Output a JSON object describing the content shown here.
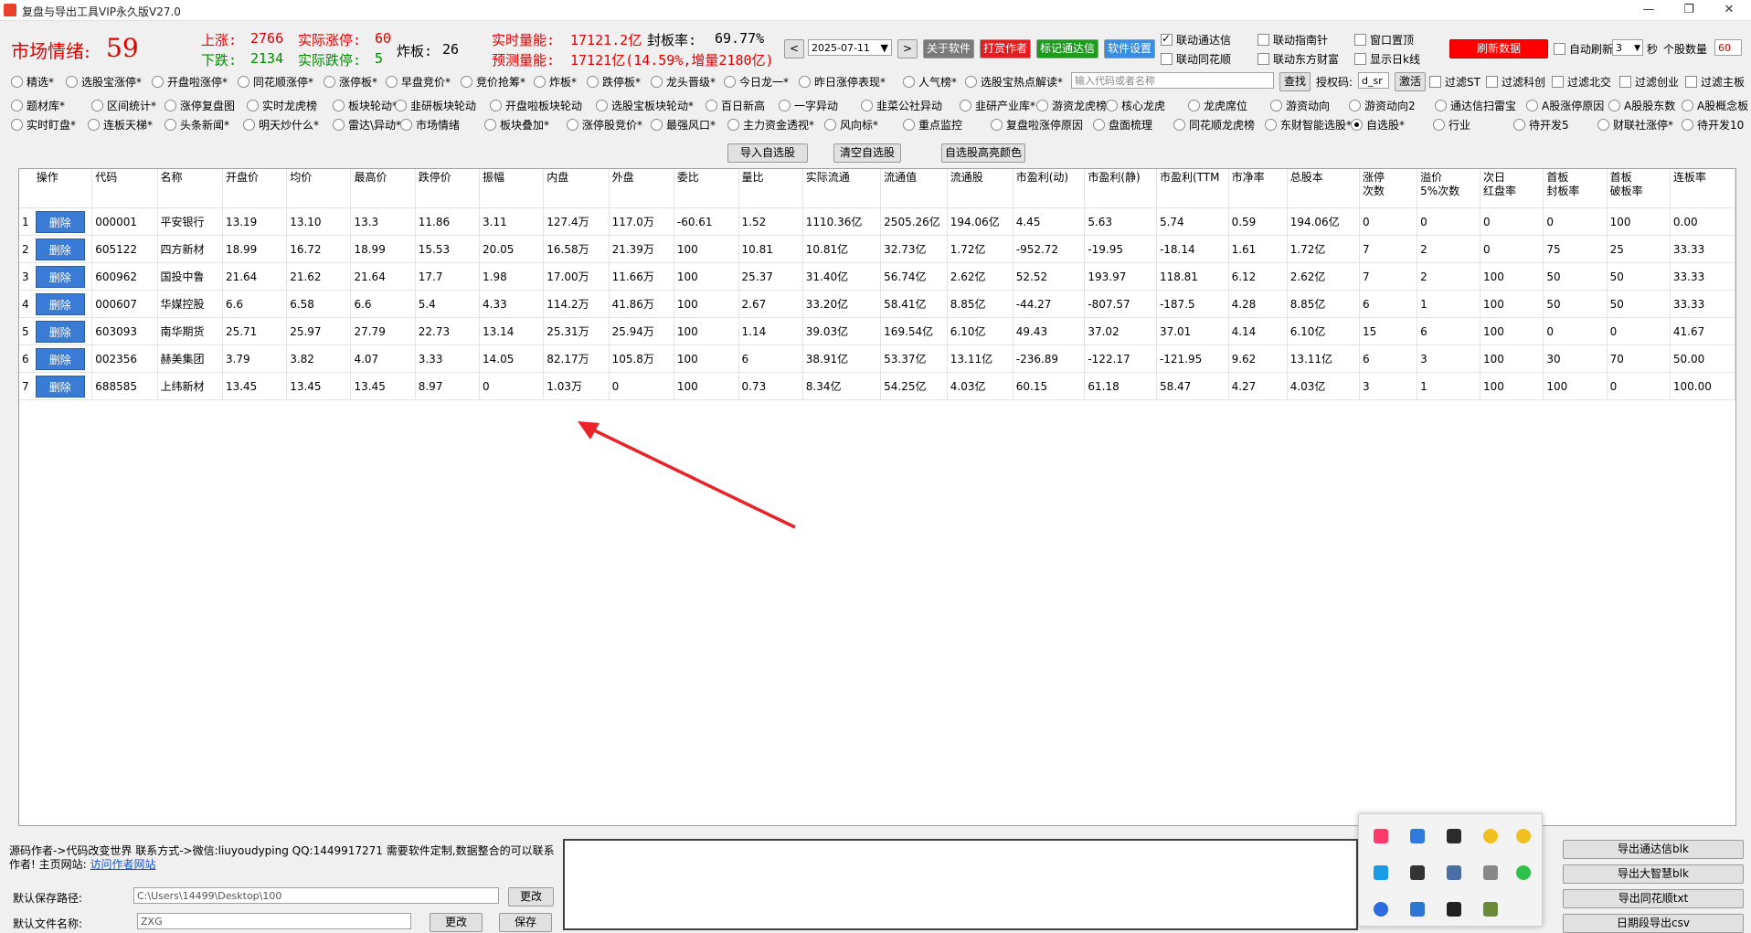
{
  "window": {
    "title": "复盘与导出工具VIP永久版V27.0",
    "min": "—",
    "max": "❐",
    "close": "✕"
  },
  "stats": {
    "mood_label": "市场情绪:",
    "mood_value": "59",
    "up_label": "上涨:",
    "up_value": "2766",
    "limit_up_label": "实际涨停:",
    "limit_up_value": "60",
    "down_label": "下跌:",
    "down_value": "2134",
    "limit_down_label": "实际跌停:",
    "limit_down_value": "5",
    "broken_label": "炸板:",
    "broken_value": "26",
    "volume_label": "实时量能:",
    "volume_value": "17121.2亿",
    "seal_label": "封板率:",
    "seal_value": "69.77%",
    "forecast_label": "预测量能:",
    "forecast_value": "17121亿(14.59%,增量2180亿)"
  },
  "toolbar": {
    "prev": "<",
    "date": "2025-07-11",
    "next": ">",
    "about": "关于软件",
    "tip": "打赏作者",
    "mark": "标记通达信",
    "settings": "软件设置",
    "refresh": "刷新数据",
    "auto_refresh": "自动刷新",
    "interval": "3",
    "seconds": "秒",
    "count_label": "个股数量",
    "count_value": "60",
    "link_tdx": "联动通达信",
    "link_ths": "联动同花顺",
    "link_znz": "联动指南针",
    "link_dfcf": "联动东方财富",
    "pin_window": "窗口置顶",
    "show_daily": "显示日k线",
    "search_placeholder": "输入代码或者名称",
    "search_btn": "查找",
    "auth_label": "授权码:",
    "auth_value": "d_sr",
    "activate": "激活",
    "filter_st": "过滤ST",
    "filter_kc": "过滤科创",
    "filter_bj": "过滤北交",
    "filter_cy": "过滤创业",
    "filter_main": "过滤主板"
  },
  "radios": {
    "row1": [
      "精选*",
      "选股宝涨停*",
      "开盘啦涨停*",
      "同花顺涨停*",
      "涨停板*",
      "早盘竞价*",
      "竞价抢筹*",
      "炸板*",
      "跌停板*",
      "龙头晋级*",
      "今日龙一*",
      "昨日涨停表现*",
      "人气榜*",
      "选股宝热点解读*"
    ],
    "row2": [
      "题材库*",
      "区间统计*",
      "涨停复盘图",
      "实时龙虎榜",
      "板块轮动*",
      "韭研板块轮动",
      "开盘啦板块轮动",
      "选股宝板块轮动*",
      "百日新高",
      "一字异动",
      "韭菜公社异动",
      "韭研产业库*",
      "游资龙虎榜",
      "核心龙虎",
      "龙虎席位",
      "游资动向",
      "游资动向2",
      "通达信扫雷宝",
      "A股涨停原因",
      "A股股东数",
      "A股概念板"
    ],
    "row3": [
      "实时盯盘*",
      "连板天梯*",
      "头条新闻*",
      "明天炒什么*",
      "雷达\\异动*",
      "市场情绪",
      "板块叠加*",
      "涨停股竞价*",
      "最强风口*",
      "主力资金透视*",
      "风向标*",
      "重点监控",
      "复盘啦涨停原因",
      "盘面梳理",
      "同花顺龙虎榜",
      "东财智能选股*",
      "自选股*",
      "行业",
      "待开发5",
      "财联社涨停*",
      "待开发10"
    ]
  },
  "actions": {
    "import": "导入自选股",
    "clear": "清空自选股",
    "highlight": "自选股高亮颜色"
  },
  "table": {
    "headers": [
      "操作",
      "代码",
      "名称",
      "开盘价",
      "均价",
      "最高价",
      "跌停价",
      "振幅",
      "内盘",
      "外盘",
      "委比",
      "量比",
      "实际流通",
      "流通值",
      "流通股",
      "市盈利(动)",
      "市盈利(静)",
      "市盈利(TTM",
      "市净率",
      "总股本",
      "涨停\n次数",
      "溢价\n5%次数",
      "次日\n红盘率",
      "首板\n封板率",
      "首板\n破板率",
      "连板率"
    ],
    "delete_label": "删除",
    "rows": [
      [
        "1",
        "000001",
        "平安银行",
        "13.19",
        "13.10",
        "13.3",
        "11.86",
        "3.11",
        "127.4万",
        "117.0万",
        "-60.61",
        "1.52",
        "1110.36亿",
        "2505.26亿",
        "194.06亿",
        "4.45",
        "5.63",
        "5.74",
        "0.59",
        "194.06亿",
        "0",
        "0",
        "0",
        "0",
        "100",
        "0.00"
      ],
      [
        "2",
        "605122",
        "四方新材",
        "18.99",
        "16.72",
        "18.99",
        "15.53",
        "20.05",
        "16.58万",
        "21.39万",
        "100",
        "10.81",
        "10.81亿",
        "32.73亿",
        "1.72亿",
        "-952.72",
        "-19.95",
        "-18.14",
        "1.61",
        "1.72亿",
        "7",
        "2",
        "0",
        "75",
        "25",
        "33.33"
      ],
      [
        "3",
        "600962",
        "国投中鲁",
        "21.64",
        "21.62",
        "21.64",
        "17.7",
        "1.98",
        "17.00万",
        "11.66万",
        "100",
        "25.37",
        "31.40亿",
        "56.74亿",
        "2.62亿",
        "52.52",
        "193.97",
        "118.81",
        "6.12",
        "2.62亿",
        "7",
        "2",
        "100",
        "50",
        "50",
        "33.33"
      ],
      [
        "4",
        "000607",
        "华媒控股",
        "6.6",
        "6.58",
        "6.6",
        "5.4",
        "4.33",
        "114.2万",
        "41.86万",
        "100",
        "2.67",
        "33.20亿",
        "58.41亿",
        "8.85亿",
        "-44.27",
        "-807.57",
        "-187.5",
        "4.28",
        "8.85亿",
        "6",
        "1",
        "100",
        "50",
        "50",
        "33.33"
      ],
      [
        "5",
        "603093",
        "南华期货",
        "25.71",
        "25.97",
        "27.79",
        "22.73",
        "13.14",
        "25.31万",
        "25.94万",
        "100",
        "1.14",
        "39.03亿",
        "169.54亿",
        "6.10亿",
        "49.43",
        "37.02",
        "37.01",
        "4.14",
        "6.10亿",
        "15",
        "6",
        "100",
        "0",
        "0",
        "41.67"
      ],
      [
        "6",
        "002356",
        "赫美集团",
        "3.79",
        "3.82",
        "4.07",
        "3.33",
        "14.05",
        "82.17万",
        "105.8万",
        "100",
        "6",
        "38.91亿",
        "53.37亿",
        "13.11亿",
        "-236.89",
        "-122.17",
        "-121.95",
        "9.62",
        "13.11亿",
        "6",
        "3",
        "100",
        "30",
        "70",
        "50.00"
      ],
      [
        "7",
        "688585",
        "上纬新材",
        "13.45",
        "13.45",
        "13.45",
        "8.97",
        "0",
        "1.03万",
        "0",
        "100",
        "0.73",
        "8.34亿",
        "54.25亿",
        "4.03亿",
        "60.15",
        "61.18",
        "58.47",
        "4.27",
        "4.03亿",
        "3",
        "1",
        "100",
        "100",
        "0",
        "100.00"
      ]
    ]
  },
  "bottom": {
    "author_info": "源码作者->代码改变世界 联系方式->微信:liuyoudyping QQ:1449917271 需要软件定制,数据整合的可以联系作者! 主页网站:",
    "author_link": "访问作者网站",
    "save_path_label": "默认保存路径:",
    "save_path_value": "C:\\Users\\14499\\Desktop\\100",
    "change_btn": "更改",
    "file_name_label": "默认文件名称:",
    "file_name_value": "ZXG",
    "change_btn2": "更改",
    "save_btn": "保存",
    "export_tdx": "导出通达信blk",
    "export_dzh": "导出大智慧blk",
    "export_ths": "导出同花顺txt",
    "export_date": "日期段导出csv"
  },
  "colors": {
    "red": "#e00000",
    "green": "#008a00",
    "blue_btn": "#3a7bd5",
    "refresh_bg": "#ff0000",
    "tip_bg": "#e02020",
    "mark_bg": "#1e9a1e",
    "settings_bg": "#3a8de0",
    "about_bg": "#7a7a7a"
  }
}
